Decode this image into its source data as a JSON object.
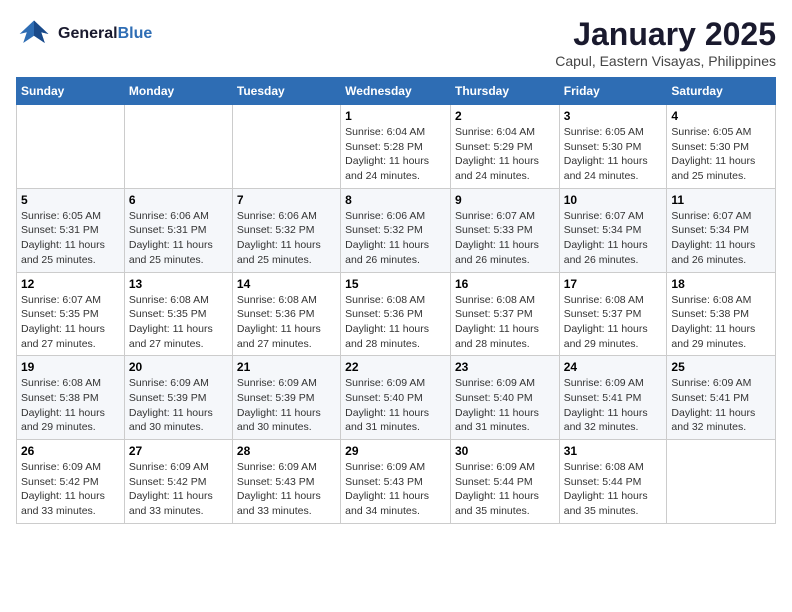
{
  "logo": {
    "line1": "General",
    "line2": "Blue"
  },
  "title": "January 2025",
  "location": "Capul, Eastern Visayas, Philippines",
  "days_of_week": [
    "Sunday",
    "Monday",
    "Tuesday",
    "Wednesday",
    "Thursday",
    "Friday",
    "Saturday"
  ],
  "weeks": [
    [
      {
        "day": "",
        "sunrise": "",
        "sunset": "",
        "daylight": ""
      },
      {
        "day": "",
        "sunrise": "",
        "sunset": "",
        "daylight": ""
      },
      {
        "day": "",
        "sunrise": "",
        "sunset": "",
        "daylight": ""
      },
      {
        "day": "1",
        "sunrise": "Sunrise: 6:04 AM",
        "sunset": "Sunset: 5:28 PM",
        "daylight": "Daylight: 11 hours and 24 minutes."
      },
      {
        "day": "2",
        "sunrise": "Sunrise: 6:04 AM",
        "sunset": "Sunset: 5:29 PM",
        "daylight": "Daylight: 11 hours and 24 minutes."
      },
      {
        "day": "3",
        "sunrise": "Sunrise: 6:05 AM",
        "sunset": "Sunset: 5:30 PM",
        "daylight": "Daylight: 11 hours and 24 minutes."
      },
      {
        "day": "4",
        "sunrise": "Sunrise: 6:05 AM",
        "sunset": "Sunset: 5:30 PM",
        "daylight": "Daylight: 11 hours and 25 minutes."
      }
    ],
    [
      {
        "day": "5",
        "sunrise": "Sunrise: 6:05 AM",
        "sunset": "Sunset: 5:31 PM",
        "daylight": "Daylight: 11 hours and 25 minutes."
      },
      {
        "day": "6",
        "sunrise": "Sunrise: 6:06 AM",
        "sunset": "Sunset: 5:31 PM",
        "daylight": "Daylight: 11 hours and 25 minutes."
      },
      {
        "day": "7",
        "sunrise": "Sunrise: 6:06 AM",
        "sunset": "Sunset: 5:32 PM",
        "daylight": "Daylight: 11 hours and 25 minutes."
      },
      {
        "day": "8",
        "sunrise": "Sunrise: 6:06 AM",
        "sunset": "Sunset: 5:32 PM",
        "daylight": "Daylight: 11 hours and 26 minutes."
      },
      {
        "day": "9",
        "sunrise": "Sunrise: 6:07 AM",
        "sunset": "Sunset: 5:33 PM",
        "daylight": "Daylight: 11 hours and 26 minutes."
      },
      {
        "day": "10",
        "sunrise": "Sunrise: 6:07 AM",
        "sunset": "Sunset: 5:34 PM",
        "daylight": "Daylight: 11 hours and 26 minutes."
      },
      {
        "day": "11",
        "sunrise": "Sunrise: 6:07 AM",
        "sunset": "Sunset: 5:34 PM",
        "daylight": "Daylight: 11 hours and 26 minutes."
      }
    ],
    [
      {
        "day": "12",
        "sunrise": "Sunrise: 6:07 AM",
        "sunset": "Sunset: 5:35 PM",
        "daylight": "Daylight: 11 hours and 27 minutes."
      },
      {
        "day": "13",
        "sunrise": "Sunrise: 6:08 AM",
        "sunset": "Sunset: 5:35 PM",
        "daylight": "Daylight: 11 hours and 27 minutes."
      },
      {
        "day": "14",
        "sunrise": "Sunrise: 6:08 AM",
        "sunset": "Sunset: 5:36 PM",
        "daylight": "Daylight: 11 hours and 27 minutes."
      },
      {
        "day": "15",
        "sunrise": "Sunrise: 6:08 AM",
        "sunset": "Sunset: 5:36 PM",
        "daylight": "Daylight: 11 hours and 28 minutes."
      },
      {
        "day": "16",
        "sunrise": "Sunrise: 6:08 AM",
        "sunset": "Sunset: 5:37 PM",
        "daylight": "Daylight: 11 hours and 28 minutes."
      },
      {
        "day": "17",
        "sunrise": "Sunrise: 6:08 AM",
        "sunset": "Sunset: 5:37 PM",
        "daylight": "Daylight: 11 hours and 29 minutes."
      },
      {
        "day": "18",
        "sunrise": "Sunrise: 6:08 AM",
        "sunset": "Sunset: 5:38 PM",
        "daylight": "Daylight: 11 hours and 29 minutes."
      }
    ],
    [
      {
        "day": "19",
        "sunrise": "Sunrise: 6:08 AM",
        "sunset": "Sunset: 5:38 PM",
        "daylight": "Daylight: 11 hours and 29 minutes."
      },
      {
        "day": "20",
        "sunrise": "Sunrise: 6:09 AM",
        "sunset": "Sunset: 5:39 PM",
        "daylight": "Daylight: 11 hours and 30 minutes."
      },
      {
        "day": "21",
        "sunrise": "Sunrise: 6:09 AM",
        "sunset": "Sunset: 5:39 PM",
        "daylight": "Daylight: 11 hours and 30 minutes."
      },
      {
        "day": "22",
        "sunrise": "Sunrise: 6:09 AM",
        "sunset": "Sunset: 5:40 PM",
        "daylight": "Daylight: 11 hours and 31 minutes."
      },
      {
        "day": "23",
        "sunrise": "Sunrise: 6:09 AM",
        "sunset": "Sunset: 5:40 PM",
        "daylight": "Daylight: 11 hours and 31 minutes."
      },
      {
        "day": "24",
        "sunrise": "Sunrise: 6:09 AM",
        "sunset": "Sunset: 5:41 PM",
        "daylight": "Daylight: 11 hours and 32 minutes."
      },
      {
        "day": "25",
        "sunrise": "Sunrise: 6:09 AM",
        "sunset": "Sunset: 5:41 PM",
        "daylight": "Daylight: 11 hours and 32 minutes."
      }
    ],
    [
      {
        "day": "26",
        "sunrise": "Sunrise: 6:09 AM",
        "sunset": "Sunset: 5:42 PM",
        "daylight": "Daylight: 11 hours and 33 minutes."
      },
      {
        "day": "27",
        "sunrise": "Sunrise: 6:09 AM",
        "sunset": "Sunset: 5:42 PM",
        "daylight": "Daylight: 11 hours and 33 minutes."
      },
      {
        "day": "28",
        "sunrise": "Sunrise: 6:09 AM",
        "sunset": "Sunset: 5:43 PM",
        "daylight": "Daylight: 11 hours and 33 minutes."
      },
      {
        "day": "29",
        "sunrise": "Sunrise: 6:09 AM",
        "sunset": "Sunset: 5:43 PM",
        "daylight": "Daylight: 11 hours and 34 minutes."
      },
      {
        "day": "30",
        "sunrise": "Sunrise: 6:09 AM",
        "sunset": "Sunset: 5:44 PM",
        "daylight": "Daylight: 11 hours and 35 minutes."
      },
      {
        "day": "31",
        "sunrise": "Sunrise: 6:08 AM",
        "sunset": "Sunset: 5:44 PM",
        "daylight": "Daylight: 11 hours and 35 minutes."
      },
      {
        "day": "",
        "sunrise": "",
        "sunset": "",
        "daylight": ""
      }
    ]
  ]
}
